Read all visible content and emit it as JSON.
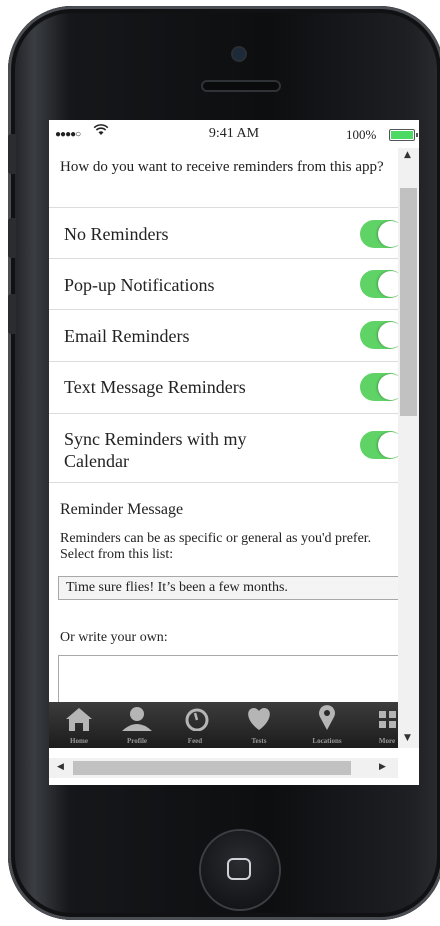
{
  "status_bar": {
    "time": "9:41 AM",
    "battery": "100%",
    "signal": "●●●●○",
    "wifi": "wifi-icon",
    "battery_color": "#4cd964"
  },
  "question": "How do you want to receive reminders from this app?",
  "options": [
    {
      "label": "No Reminders",
      "enabled": true
    },
    {
      "label": "Pop-up Notifications",
      "enabled": true
    },
    {
      "label": "Email Reminders",
      "enabled": true
    },
    {
      "label": "Text Message Reminders",
      "enabled": true
    },
    {
      "label": "Sync Reminders with my Calendar",
      "enabled": true
    }
  ],
  "toggle_color": "#5fd366",
  "reminder_message": {
    "title": "Reminder Message",
    "description": "Reminders can be as specific or general as you'd prefer. Select from this list:",
    "selected_option": "Time sure flies! It’s been a few months.",
    "write_label": "Or write your own:",
    "textarea_value": ""
  },
  "tab_bar": [
    {
      "label": "Home",
      "icon": "home-icon"
    },
    {
      "label": "Profile",
      "icon": "profile-icon"
    },
    {
      "label": "Feed",
      "icon": "feed-icon"
    },
    {
      "label": "Tests",
      "icon": "heart-icon"
    },
    {
      "label": "Locations",
      "icon": "location-pin-icon"
    },
    {
      "label": "More",
      "icon": "grid-icon"
    }
  ]
}
